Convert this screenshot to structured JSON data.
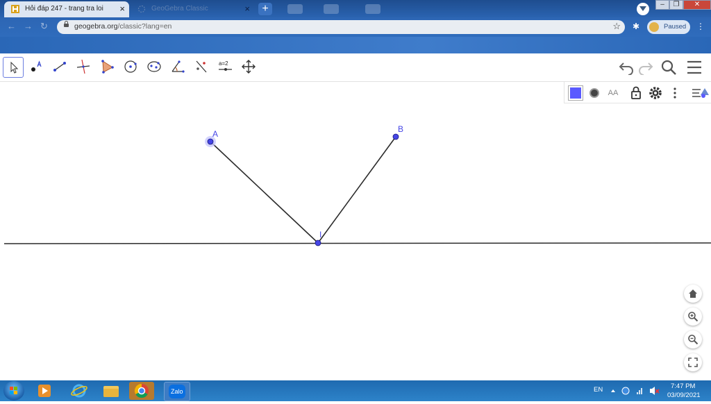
{
  "browser": {
    "tabs": [
      {
        "title": "Hỏi đáp 247 - trang tra loi",
        "close": "×"
      },
      {
        "title": "GeoGebra Classic",
        "close": "×"
      }
    ],
    "new_tab": "+",
    "url_host": "geogebra.org",
    "url_path": "/classic?lang=en",
    "profile_label": "Paused"
  },
  "geogebra": {
    "toolbar": [
      {
        "name": "tool-move",
        "icon": "arrow-cursor-icon"
      },
      {
        "name": "tool-point",
        "icon": "point-icon"
      },
      {
        "name": "tool-segment",
        "icon": "segment-icon"
      },
      {
        "name": "tool-perpendicular",
        "icon": "perpendicular-line-icon"
      },
      {
        "name": "tool-polygon",
        "icon": "polygon-icon"
      },
      {
        "name": "tool-circle",
        "icon": "circle-icon"
      },
      {
        "name": "tool-ellipse",
        "icon": "ellipse-icon"
      },
      {
        "name": "tool-angle",
        "icon": "angle-icon"
      },
      {
        "name": "tool-reflect",
        "icon": "reflect-icon"
      },
      {
        "name": "tool-slider",
        "icon": "slider-icon",
        "label": "a=2"
      },
      {
        "name": "tool-move-view",
        "icon": "move-graphics-icon"
      }
    ],
    "points": {
      "A": {
        "label": "A"
      },
      "B": {
        "label": "B"
      },
      "I": {
        "label": "I"
      }
    },
    "colors": {
      "point": "#4646e6",
      "line": "#2b2b2b",
      "selected": "#5a5aff"
    },
    "style_bar": [
      "color-swatch-icon",
      "point-style-icon",
      "text-size-icon",
      "lock-icon",
      "settings-icon",
      "more-icon",
      "toggle-style-bar-icon"
    ],
    "style_bar_text": "AA"
  },
  "taskbar": {
    "language": "EN",
    "time": "7:47 PM",
    "date": "03/09/2021",
    "zalo": "Zalo"
  }
}
